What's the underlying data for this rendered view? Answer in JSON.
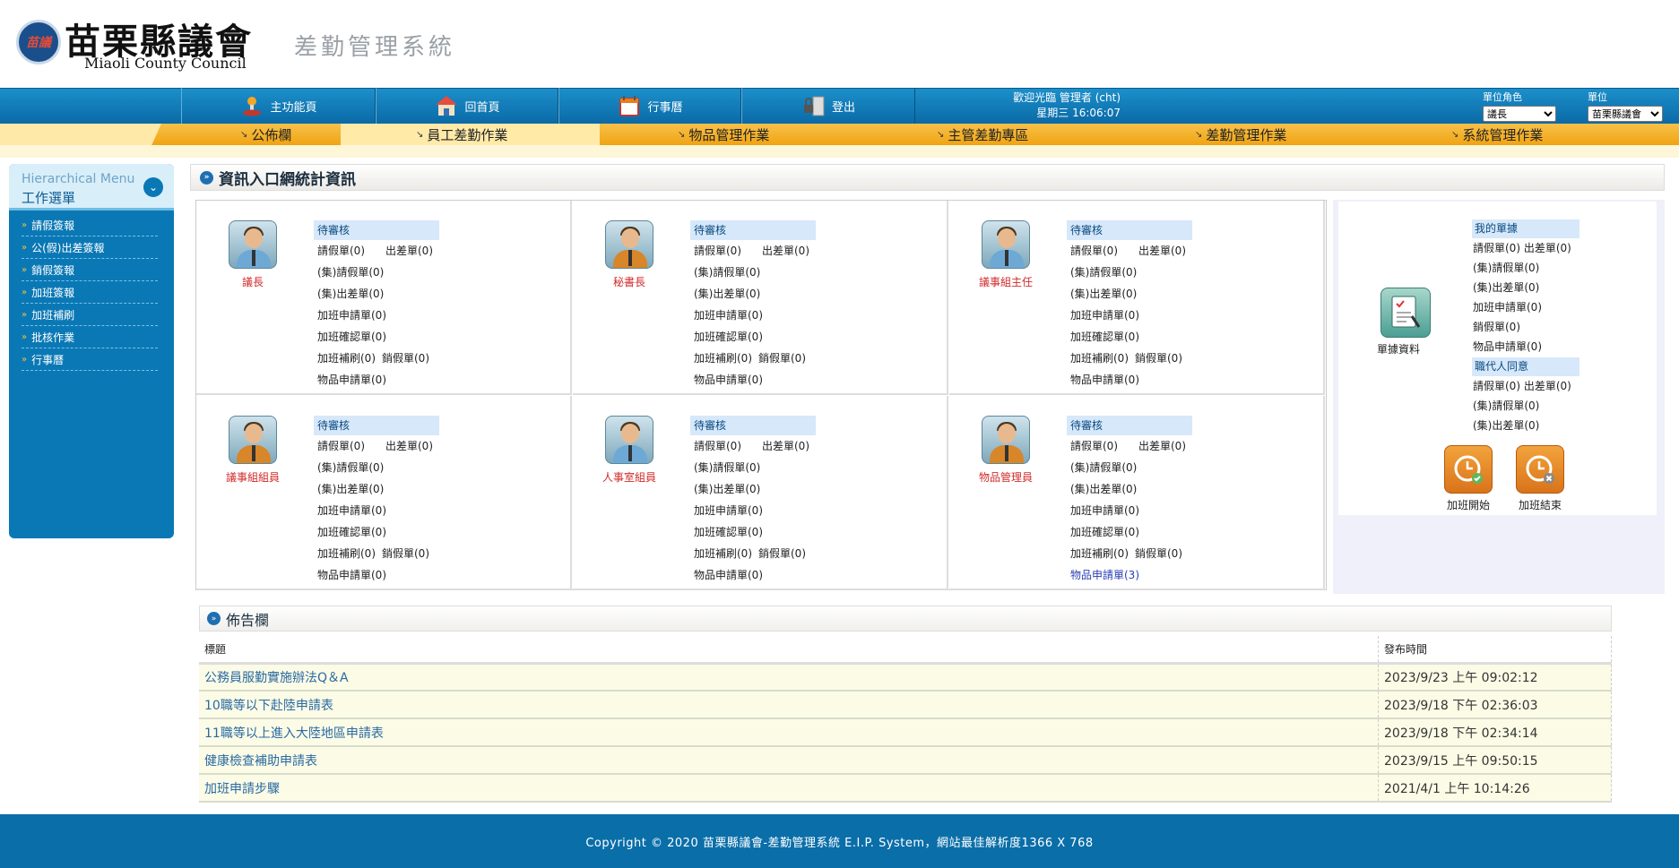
{
  "header": {
    "seal_text": "苗議",
    "title_zh": "苗栗縣議會",
    "title_en": "Miaoli County Council",
    "system_title": "差勤管理系統"
  },
  "topnav": {
    "items": [
      {
        "label": "主功能頁",
        "icon": "home-joystick-icon"
      },
      {
        "label": "回首頁",
        "icon": "house-icon"
      },
      {
        "label": "行事曆",
        "icon": "calendar-icon"
      },
      {
        "label": "登出",
        "icon": "lock-door-icon"
      }
    ],
    "welcome": "歡迎光臨  管理者 (cht)",
    "datetime": "星期三 16:06:07",
    "unit_role_label": "單位角色",
    "unit_role_value": "議長",
    "unit_label": "單位",
    "unit_value": "苗栗縣議會"
  },
  "menu": {
    "items": [
      {
        "label": "公佈欄"
      },
      {
        "label": "員工差勤作業"
      },
      {
        "label": "物品管理作業"
      },
      {
        "label": "主管差勤專區"
      },
      {
        "label": "差勤管理作業"
      },
      {
        "label": "系統管理作業"
      }
    ]
  },
  "sidebar": {
    "title_en": "Hierarchical Menu",
    "title_zh": "工作選單",
    "items": [
      "請假簽報",
      "公(假)出差簽報",
      "銷假簽報",
      "加班簽報",
      "加班補刷",
      "批核作業",
      "行事曆"
    ]
  },
  "portal": {
    "title": "資訊入口網統計資訊",
    "pending_label": "待審核",
    "cells": [
      {
        "role": "議長",
        "rows": [
          "請假單(0)",
          "出差單(0)",
          "(集)請假單(0)",
          "(集)出差單(0)",
          "加班申請單(0)",
          "加班確認單(0)",
          "加班補刷(0)",
          "銷假單(0)",
          "物品申請單(0)"
        ]
      },
      {
        "role": "秘書長",
        "rows": [
          "請假單(0)",
          "出差單(0)",
          "(集)請假單(0)",
          "(集)出差單(0)",
          "加班申請單(0)",
          "加班確認單(0)",
          "加班補刷(0)",
          "銷假單(0)",
          "物品申請單(0)"
        ]
      },
      {
        "role": "議事組主任",
        "rows": [
          "請假單(0)",
          "出差單(0)",
          "(集)請假單(0)",
          "(集)出差單(0)",
          "加班申請單(0)",
          "加班確認單(0)",
          "加班補刷(0)",
          "銷假單(0)",
          "物品申請單(0)"
        ]
      },
      {
        "role": "議事組組員",
        "rows": [
          "請假單(0)",
          "出差單(0)",
          "(集)請假單(0)",
          "(集)出差單(0)",
          "加班申請單(0)",
          "加班確認單(0)",
          "加班補刷(0)",
          "銷假單(0)",
          "物品申請單(0)"
        ]
      },
      {
        "role": "人事室組員",
        "rows": [
          "請假單(0)",
          "出差單(0)",
          "(集)請假單(0)",
          "(集)出差單(0)",
          "加班申請單(0)",
          "加班確認單(0)",
          "加班補刷(0)",
          "銷假單(0)",
          "物品申請單(0)"
        ]
      },
      {
        "role": "物品管理員",
        "rows": [
          "請假單(0)",
          "出差單(0)",
          "(集)請假單(0)",
          "(集)出差單(0)",
          "加班申請單(0)",
          "加班確認單(0)",
          "加班補刷(0)",
          "銷假單(0)",
          "物品申請單(3)"
        ]
      }
    ],
    "summary": {
      "doc_label": "單據資料",
      "my_forms_label": "我的單據",
      "my_forms": [
        "請假單(0) 出差單(0)",
        "(集)請假單(0)",
        "(集)出差單(0)",
        "加班申請單(0)",
        "銷假單(0)",
        "物品申請單(0)"
      ],
      "agent_label": "職代人同意",
      "agent_forms": [
        "請假單(0) 出差單(0)",
        "(集)請假單(0)",
        "(集)出差單(0)"
      ],
      "ot_start": "加班開始",
      "ot_end": "加班結束"
    }
  },
  "bulletin": {
    "title": "佈告欄",
    "col_title": "標題",
    "col_date": "發布時間",
    "rows": [
      {
        "title": "公務員服勤實施辦法Q＆A",
        "date": "2023/9/23 上午 09:02:12"
      },
      {
        "title": "10職等以下赴陸申請表",
        "date": "2023/9/18 下午 02:36:03"
      },
      {
        "title": "11職等以上進入大陸地區申請表",
        "date": "2023/9/18 下午 02:34:14"
      },
      {
        "title": "健康檢查補助申請表",
        "date": "2023/9/15 上午 09:50:15"
      },
      {
        "title": "加班申請步驟",
        "date": "2021/4/1 上午 10:14:26"
      }
    ]
  },
  "footer": {
    "copyright": "Copyright © 2020 苗栗縣議會-差勤管理系統 E.I.P. System，網站最佳解析度1366 X 768"
  }
}
